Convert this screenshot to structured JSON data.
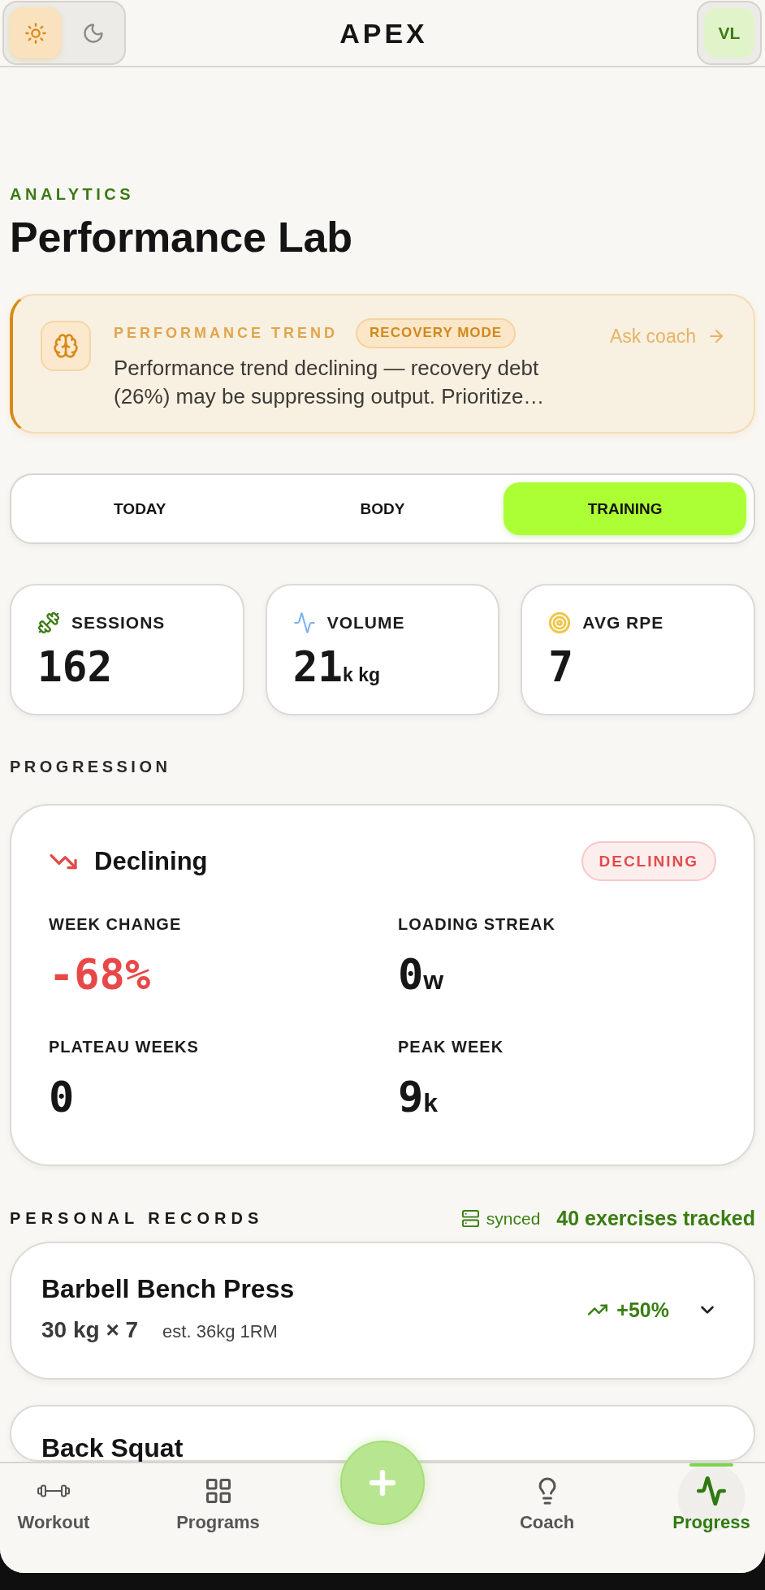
{
  "header": {
    "theme_toggle": [
      {
        "kind": "light",
        "selected": true
      },
      {
        "kind": "dark",
        "selected": false
      }
    ],
    "title": "APEX",
    "avatar": {
      "initials": "VL"
    }
  },
  "page": {
    "eyebrow": "ANALYTICS",
    "title": "Performance Lab"
  },
  "insight": {
    "label": "PERFORMANCE TREND",
    "badge": "RECOVERY MODE",
    "message": "Performance trend declining — recovery debt (26%) may be suppressing output. Prioritize…",
    "action": "Ask coach"
  },
  "tabs": [
    {
      "label": "TODAY",
      "selected": false
    },
    {
      "label": "BODY",
      "selected": false
    },
    {
      "label": "TRAINING",
      "selected": true
    }
  ],
  "stats": [
    {
      "kind": "sessions",
      "label": "SESSIONS",
      "value": "162"
    },
    {
      "kind": "volume",
      "label": "VOLUME",
      "value": "21",
      "unit": "k kg"
    },
    {
      "kind": "rpe",
      "label": "AVG RPE",
      "value": "7"
    }
  ],
  "progression": {
    "heading": "PROGRESSION",
    "declining": true,
    "status": "Declining",
    "badge": "DECLINING",
    "metrics": [
      {
        "label": "WEEK CHANGE",
        "value": "-68%",
        "negative": true
      },
      {
        "label": "LOADING STREAK",
        "value": "0",
        "unit": "w",
        "negative": false
      },
      {
        "label": "PLATEAU WEEKS",
        "value": "0",
        "negative": false
      },
      {
        "label": "PEAK WEEK",
        "value": "9",
        "unit": "k",
        "negative": false
      }
    ]
  },
  "personal_records": {
    "heading": "PERSONAL RECORDS",
    "sync_status": "synced",
    "count": "40 exercises tracked",
    "records": [
      {
        "name": "Barbell Bench Press",
        "best": "30 kg × 7",
        "estimate": "est. 36kg 1RM",
        "improving": true,
        "change": "+50%",
        "expanded": false
      },
      {
        "name": "Back Squat"
      }
    ]
  },
  "bottom_nav": {
    "items": [
      {
        "kind": "workout",
        "label": "Workout",
        "selected": false
      },
      {
        "kind": "programs",
        "label": "Programs",
        "selected": false
      },
      {
        "kind": "coach",
        "label": "Coach",
        "selected": false
      },
      {
        "kind": "progress",
        "label": "Progress",
        "selected": true
      }
    ],
    "action_button": {
      "kind": "add"
    }
  }
}
